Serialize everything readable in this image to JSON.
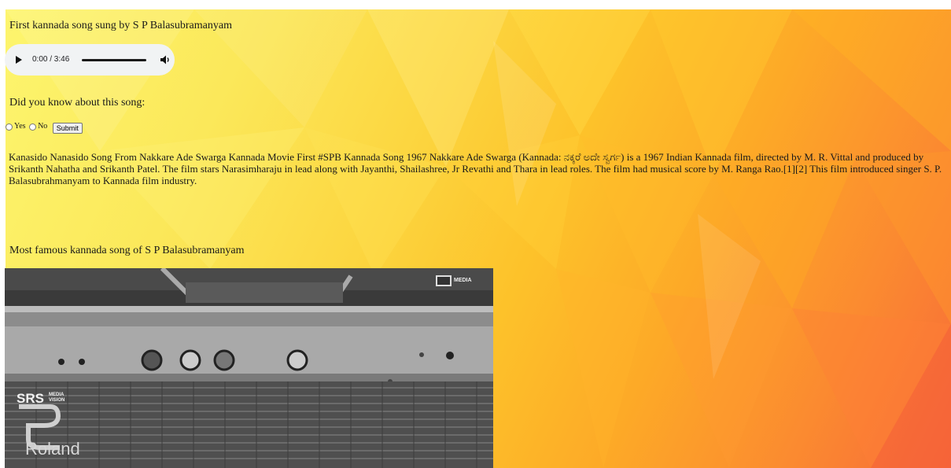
{
  "section1": {
    "title": "First kannada song sung by S P Balasubramanyam"
  },
  "audio_player": {
    "time": "0:00 / 3:46",
    "progress": 0,
    "play_icon": "play-icon",
    "volume_icon": "volume-icon"
  },
  "poll": {
    "question": "Did you know about this song:",
    "options": [
      "Yes",
      "No"
    ],
    "submit_label": "Submit"
  },
  "description": "Kanasido Nanasido Song From Nakkare Ade Swarga Kannada Movie First #SPB Kannada Song 1967 Nakkare Ade Swarga (Kannada: ನಕ್ಕರೆ ಅದೇ ಸ್ವರ್ಗ) is a 1967 Indian Kannada film, directed by M. R. Vittal and produced by Srikanth Nahatha and Srikanth Patel. The film stars Narasimharaju in lead along with Jayanthi, Shailashree, Jr Revathi and Thara in lead roles. The film had musical score by M. Ranga Rao.[1][2] This film introduced singer S. P. Balasubrahmanyam to Kannada film industry.",
  "section2": {
    "title": "Most famous kannada song of S P Balasubramanyam"
  },
  "video": {
    "watermark_top": "MEDIA",
    "logo_srs": "SRS",
    "logo_media": "MEDIA",
    "logo_vision": "VISION",
    "brand": "Roland"
  },
  "colors": {
    "bg_yellow": "#fdf56e",
    "bg_orange": "#fda927",
    "bg_red": "#f76a39",
    "player_bg": "#f1f3f4"
  }
}
